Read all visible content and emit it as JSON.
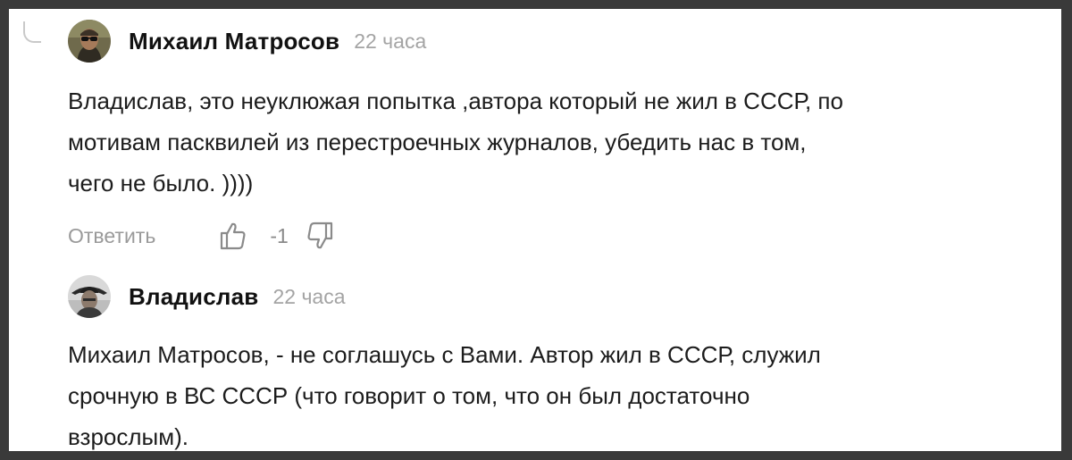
{
  "comments": [
    {
      "author": "Михаил Матросов",
      "time": "22 часа",
      "text": "Владислав, это неуклюжая попытка ,автора который не жил в СССР, по\nмотивам пасквилей из перестроечных журналов, убедить нас в том,\nчего не было. ))))",
      "reply_label": "Ответить",
      "score": "-1",
      "avatar_icon": "avatar-man-sunglasses"
    },
    {
      "author": "Владислав",
      "time": "22 часа",
      "text": "Михаил Матросов, - не соглашусь с Вами. Автор жил в СССР, служил\nсрочную в ВС СССР (что говорит о том, что он был достаточно\nвзрослым).",
      "avatar_icon": "avatar-man-hat"
    }
  ],
  "icons": {
    "like": "thumbs-up-icon",
    "dislike": "thumbs-down-icon"
  },
  "colors": {
    "background": "#ffffff",
    "border": "#3a3a3a",
    "text": "#1c1c1c",
    "muted": "#a4a4a4"
  }
}
